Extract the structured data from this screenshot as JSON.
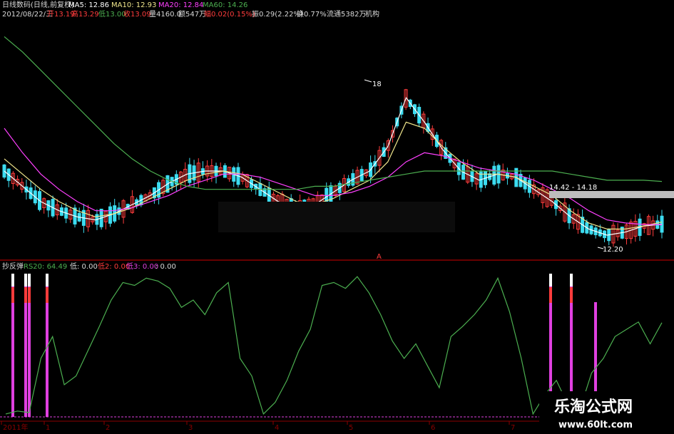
{
  "header": {
    "title": "日线数码(日线,前复权)",
    "ma5": "MA5: 12.86",
    "ma10": "MA10: 12.93",
    "ma20": "MA20: 12.84",
    "ma60": "MA60: 14.26",
    "info_date": "2012/08/22/三",
    "info_open": "开13.19",
    "info_high": "高13.29",
    "info_low": "低13.00",
    "info_close": "收13.09",
    "info_vol": "量4160.0",
    "info_amt": "额547万",
    "info_chg": "幅0.02(0.15%)",
    "info_amp": "振0.29(2.22%)",
    "info_turn": "换0.77%",
    "info_float": "流通5382万",
    "info_inst": "机构"
  },
  "price_labels": {
    "high": "18",
    "low": "12.20",
    "range": "14.42 - 14.18",
    "marker": "A"
  },
  "indicator": {
    "name": "抄反弹",
    "rs20": "RS20: 64.49",
    "low0": "低: 0.00",
    "low2": "低2: 0.00",
    "low3": "低3: 0.00",
    "tail": ": 0.00"
  },
  "x_axis": [
    "2011年",
    "1",
    "2",
    "3",
    "4",
    "5",
    "6",
    "7"
  ],
  "watermark": {
    "title": "乐淘公式网",
    "url": "www.60lt.com"
  },
  "colors": {
    "up": "#ff3c3c",
    "down": "#3cdcf0",
    "ma5": "#ffffff",
    "ma10": "#f0e68c",
    "ma20": "#ff40ff",
    "ma60": "#4caf50",
    "rs": "#4caf50",
    "signal": "#e040e0"
  },
  "chart_data": [
    {
      "type": "line",
      "title": "日线数码(日线,前复权)",
      "series": [
        {
          "name": "MA5",
          "values": [
            14.6,
            14.1,
            13.6,
            13.3,
            13.1,
            13.0,
            13.2,
            13.5,
            13.8,
            14.2,
            14.5,
            14.6,
            14.6,
            14.4,
            14.0,
            13.6,
            13.4,
            13.5,
            13.9,
            14.3,
            14.6,
            15.4,
            17.0,
            16.2,
            15.3,
            14.6,
            14.3,
            14.5,
            14.4,
            14.0,
            13.6,
            13.1,
            12.7,
            12.5,
            12.6,
            12.8,
            12.86
          ]
        },
        {
          "name": "MA10",
          "values": [
            15.0,
            14.5,
            14.0,
            13.6,
            13.3,
            13.1,
            13.2,
            13.4,
            13.7,
            14.0,
            14.3,
            14.5,
            14.6,
            14.5,
            14.2,
            13.9,
            13.6,
            13.5,
            13.7,
            14.0,
            14.3,
            14.9,
            16.2,
            16.0,
            15.4,
            14.9,
            14.5,
            14.5,
            14.4,
            14.1,
            13.8,
            13.3,
            12.9,
            12.7,
            12.7,
            12.8,
            12.93
          ]
        },
        {
          "name": "MA20",
          "values": [
            16.0,
            15.2,
            14.5,
            14.0,
            13.6,
            13.3,
            13.3,
            13.4,
            13.6,
            13.8,
            14.1,
            14.3,
            14.5,
            14.5,
            14.4,
            14.2,
            14.0,
            13.8,
            13.8,
            13.9,
            14.1,
            14.4,
            14.9,
            15.2,
            15.1,
            14.9,
            14.7,
            14.6,
            14.5,
            14.3,
            14.0,
            13.7,
            13.3,
            13.0,
            12.9,
            12.85,
            12.84
          ]
        },
        {
          "name": "MA60",
          "values": [
            19.0,
            18.5,
            17.9,
            17.3,
            16.7,
            16.1,
            15.5,
            15.0,
            14.6,
            14.3,
            14.1,
            14.0,
            14.0,
            14.0,
            14.0,
            14.0,
            14.0,
            14.1,
            14.1,
            14.2,
            14.3,
            14.4,
            14.5,
            14.6,
            14.6,
            14.6,
            14.6,
            14.6,
            14.6,
            14.6,
            14.6,
            14.5,
            14.4,
            14.3,
            14.3,
            14.3,
            14.26
          ]
        }
      ],
      "annotations": [
        "18",
        "12.20",
        "14.42 - 14.18"
      ]
    },
    {
      "type": "line",
      "title": "抄反弹",
      "series": [
        {
          "name": "RS20",
          "values": [
            2,
            4,
            3,
            40,
            55,
            22,
            28,
            45,
            62,
            80,
            92,
            90,
            95,
            93,
            88,
            75,
            80,
            70,
            85,
            92,
            40,
            28,
            2,
            10,
            25,
            45,
            60,
            90,
            92,
            88,
            96,
            85,
            70,
            52,
            40,
            50,
            35,
            20,
            55,
            62,
            70,
            80,
            95,
            72,
            40,
            2,
            15,
            25,
            8,
            5,
            30,
            40,
            55,
            60,
            65,
            50,
            64.49
          ]
        }
      ],
      "signals": [
        "1",
        "2",
        "3",
        "4",
        "5",
        "6",
        "7"
      ]
    }
  ]
}
